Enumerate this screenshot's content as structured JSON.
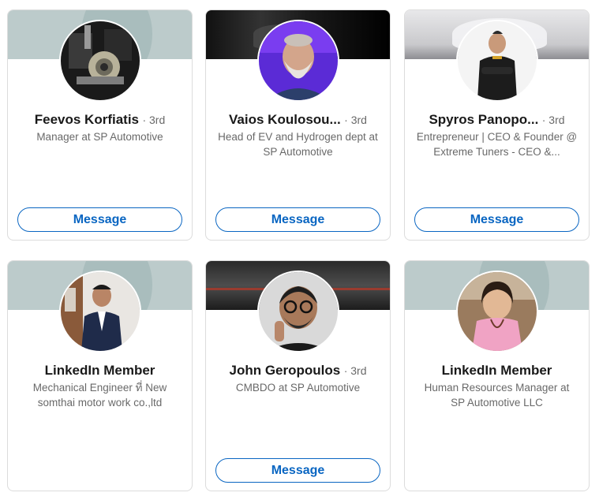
{
  "cards": [
    {
      "name": "Feevos Korfiatis",
      "degree": "· 3rd",
      "headline": "Manager at SP Automotive",
      "button": "Message",
      "banner": "sage",
      "avatar": "engine-photo"
    },
    {
      "name": "Vaios Koulosou...",
      "degree": "· 3rd",
      "headline": "Head of EV and Hydrogen dept at SP Automotive",
      "button": "Message",
      "banner": "dark-car",
      "avatar": "bearded-man-photo"
    },
    {
      "name": "Spyros Panopo...",
      "degree": "· 3rd",
      "headline": "Entrepreneur | CEO & Founder @ Extreme Tuners - CEO &...",
      "button": "Message",
      "banner": "studio",
      "avatar": "man-crossed-arms-photo"
    },
    {
      "name": "LinkedIn Member",
      "degree": "",
      "headline": "Mechanical Engineer ที่ New somthai motor work co.,ltd",
      "button": "",
      "banner": "sage",
      "avatar": "young-man-suit-photo"
    },
    {
      "name": "John Geropoulos",
      "degree": "· 3rd",
      "headline": "CMBDO at SP Automotive",
      "button": "Message",
      "banner": "dark-room",
      "avatar": "man-glasses-peace-photo"
    },
    {
      "name": "LinkedIn Member",
      "degree": "",
      "headline": "Human Resources Manager at SP Automotive LLC",
      "button": "",
      "banner": "sage",
      "avatar": "woman-pink-photo"
    }
  ],
  "colors": {
    "accent": "#0a66c2",
    "banner_sage": "#bccbcb",
    "card_border": "#dcdcdc"
  }
}
